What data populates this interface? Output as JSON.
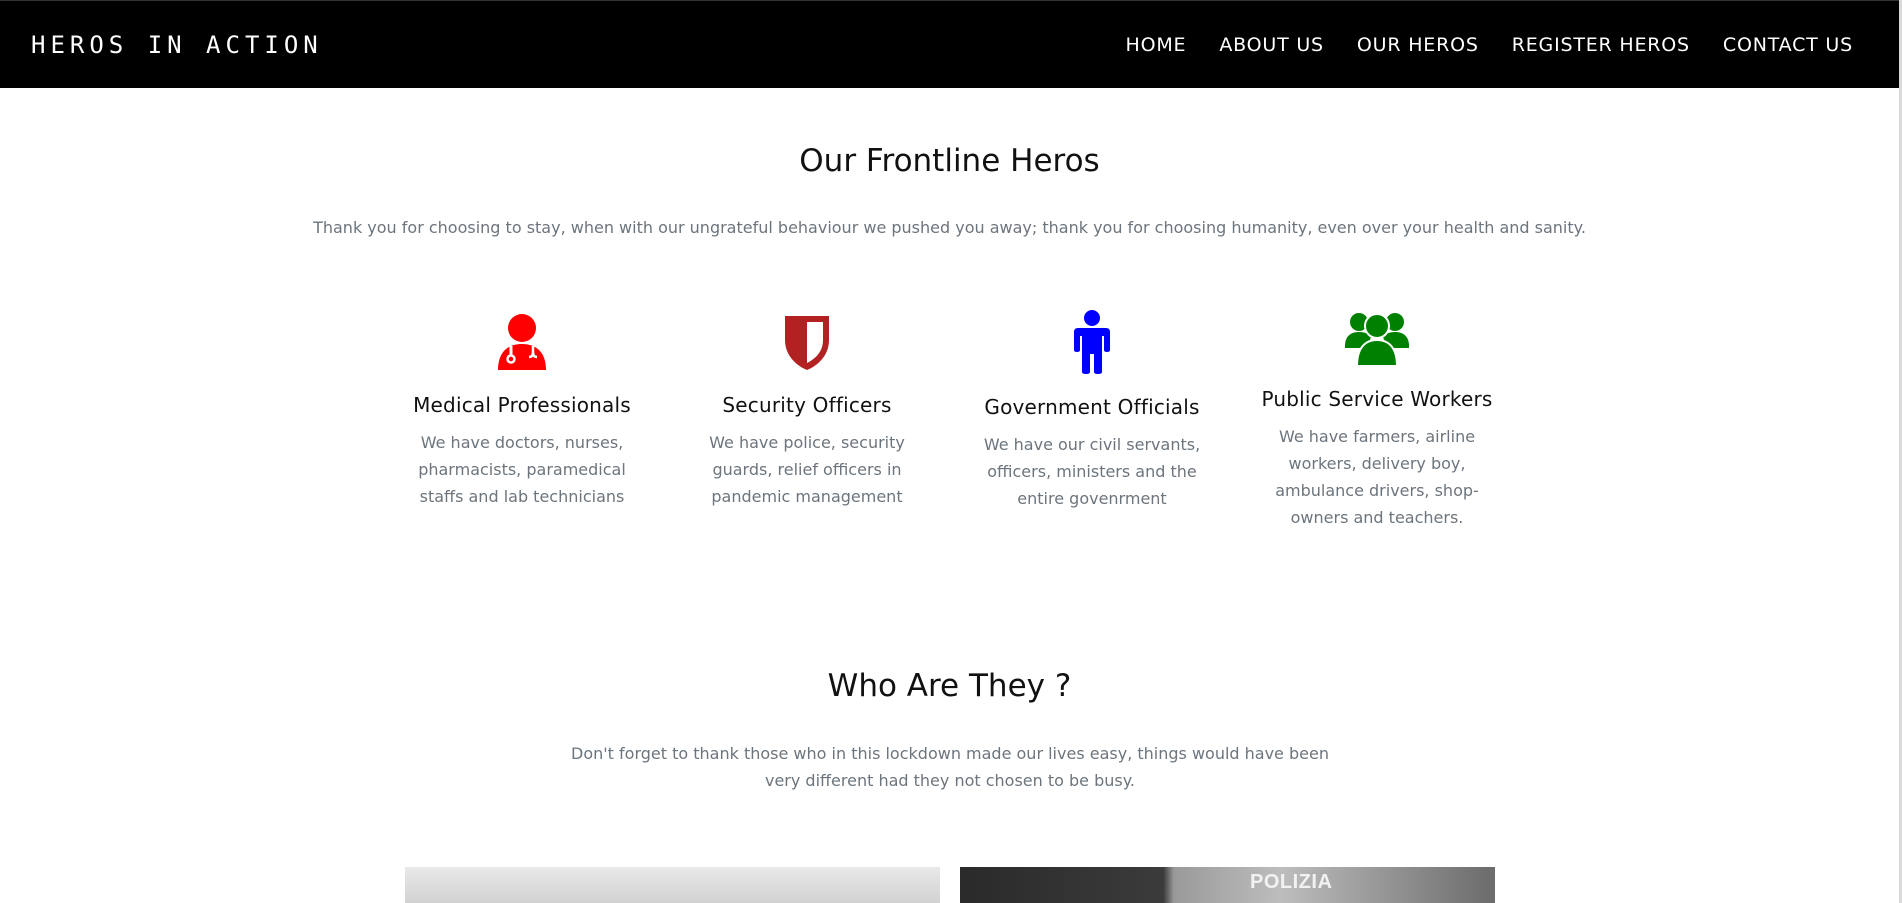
{
  "brand": "HEROS IN ACTION",
  "nav": {
    "home": "HOME",
    "about": "ABOUT US",
    "heros": "OUR HEROS",
    "register": "REGISTER HEROS",
    "contact": "CONTACT US"
  },
  "frontline": {
    "title": "Our Frontline Heros",
    "subtitle": "Thank you for choosing to stay, when with our ungrateful behaviour we pushed you away; thank you for choosing humanity, even over your health and sanity."
  },
  "cards": [
    {
      "title": "Medical Professionals",
      "text": "We have doctors, nurses, pharmacists, paramedical staffs and lab technicians",
      "icon": "doctor-icon",
      "color": "#ff0000"
    },
    {
      "title": "Security Officers",
      "text": "We have police, security guards, relief officers in pandemic management",
      "icon": "shield-icon",
      "color": "#b22222"
    },
    {
      "title": "Government Officials",
      "text": "We have our civil servants, officers, ministers and the entire govenrment",
      "icon": "person-icon",
      "color": "#0000ff"
    },
    {
      "title": "Public Service Workers",
      "text": "We have farmers, airline workers, delivery boy, ambulance drivers, shop-owners and teachers.",
      "icon": "users-icon",
      "color": "#008000"
    }
  ],
  "who": {
    "title": "Who Are They ?",
    "subtitle": "Don't forget to thank those who in this lockdown made our lives easy, things would have been very different had they not chosen to be busy."
  },
  "photos": {
    "right_sign": "POLIZIA"
  }
}
